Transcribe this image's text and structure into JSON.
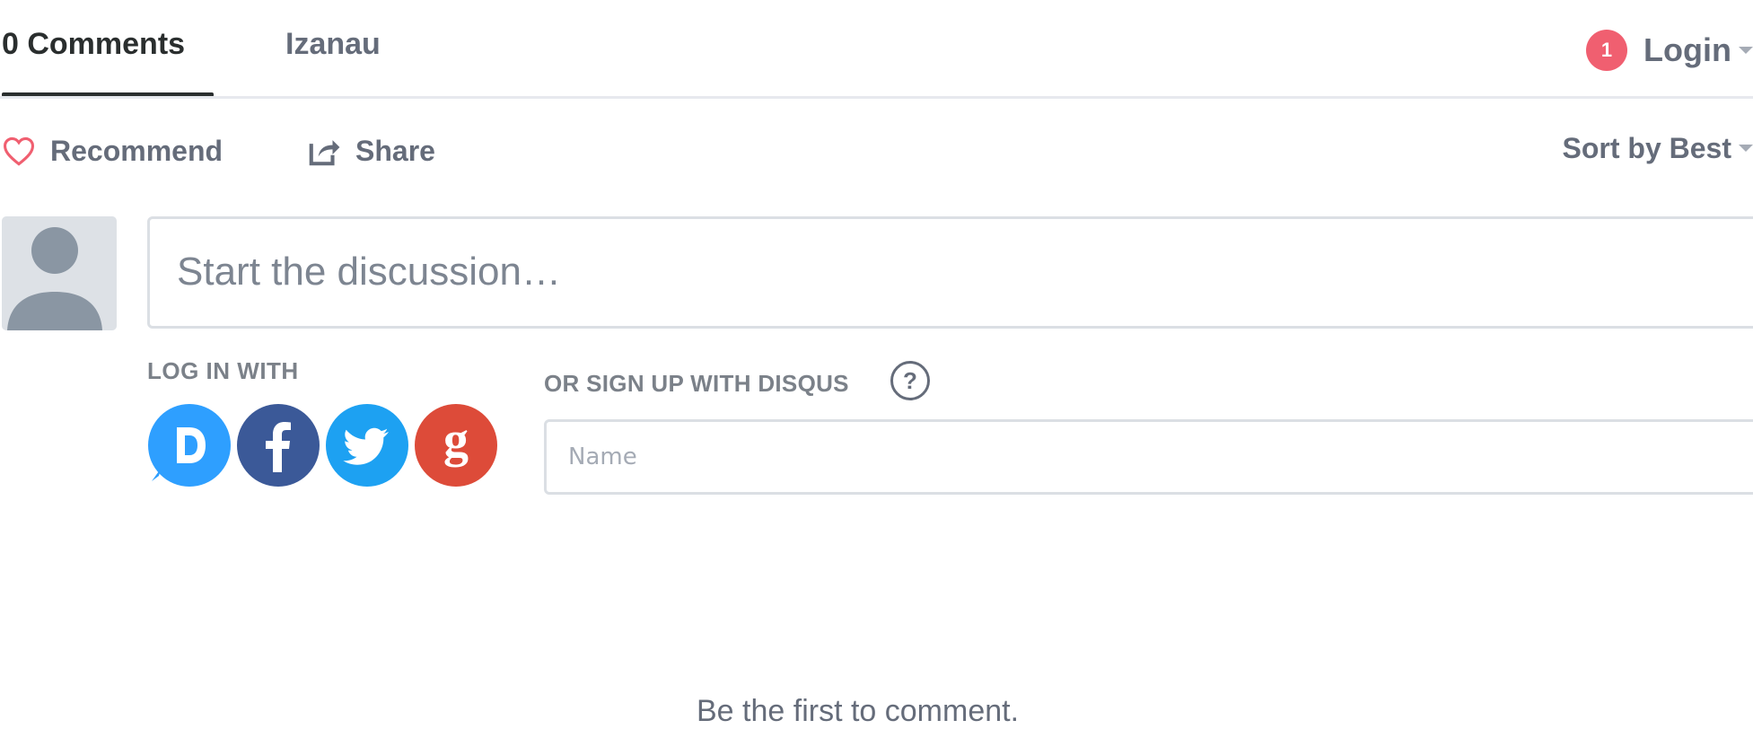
{
  "nav": {
    "comments_tab": "0 Comments",
    "site_tab": "Izanau",
    "notification_count": "1",
    "login_label": "Login"
  },
  "actions": {
    "recommend_label": "Recommend",
    "share_label": "Share",
    "sort_label": "Sort by Best"
  },
  "composer": {
    "placeholder": "Start the discussion…"
  },
  "auth": {
    "login_with_label": "LOG IN WITH",
    "signup_label": "OR SIGN UP WITH DISQUS",
    "help_symbol": "?",
    "name_placeholder": "Name",
    "providers": [
      {
        "name": "disqus",
        "icon": "disqus-icon",
        "color": "#2e9fff"
      },
      {
        "name": "facebook",
        "icon": "facebook-icon",
        "color": "#3b5998"
      },
      {
        "name": "twitter",
        "icon": "twitter-icon",
        "color": "#1da1f2"
      },
      {
        "name": "google",
        "icon": "google-icon",
        "color": "#dd4b39"
      }
    ]
  },
  "empty_message": "Be the first to comment.",
  "colors": {
    "accent_red": "#f05f70",
    "text_muted": "#656c7a",
    "border": "#dbdfe4"
  }
}
